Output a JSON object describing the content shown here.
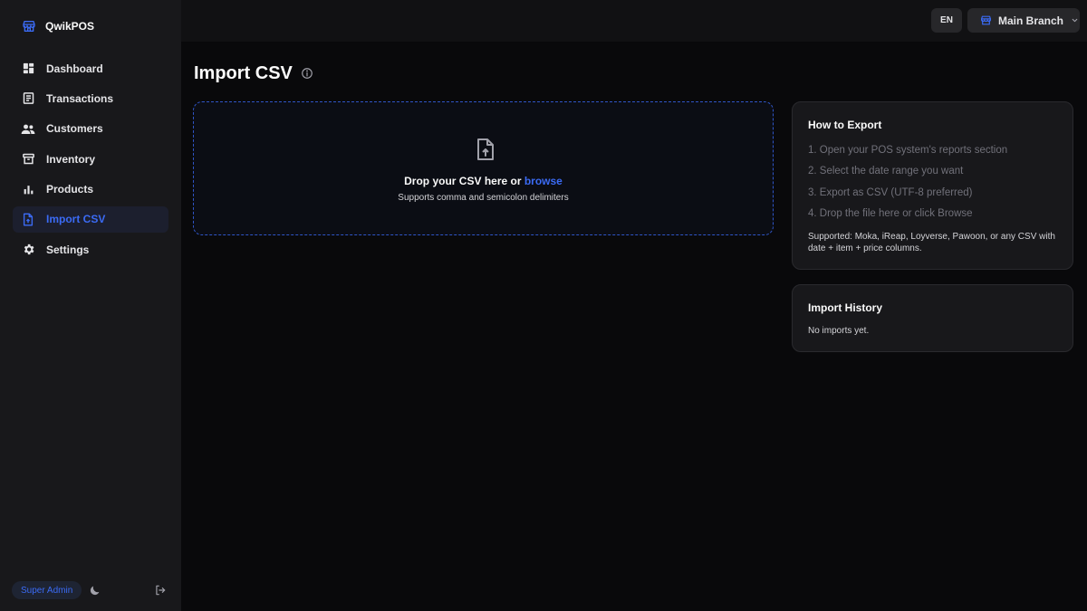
{
  "app": {
    "name": "QwikPOS",
    "accent": "#3b6bf5"
  },
  "sidebar": {
    "items": [
      {
        "label": "Dashboard",
        "icon": "dashboard-icon"
      },
      {
        "label": "Transactions",
        "icon": "receipt-icon"
      },
      {
        "label": "Customers",
        "icon": "users-icon"
      },
      {
        "label": "Inventory",
        "icon": "archive-icon"
      },
      {
        "label": "Products",
        "icon": "bar-chart-icon"
      },
      {
        "label": "Import CSV",
        "icon": "file-upload-icon",
        "active": true
      },
      {
        "label": "Settings",
        "icon": "gear-icon"
      }
    ],
    "footer": {
      "role": "Super Admin",
      "theme_icon": "moon-icon",
      "logout_icon": "logout-icon"
    }
  },
  "topbar": {
    "language": "EN",
    "branch": "Main Branch",
    "branch_icon": "store-icon",
    "chevron_icon": "chevron-down-icon"
  },
  "page": {
    "title": "Import CSV",
    "title_icon": "info-icon"
  },
  "dropzone": {
    "icon": "file-upload-icon",
    "prompt": "Drop your CSV here or",
    "browse": "browse",
    "subtext": "Supports comma and semicolon delimiters"
  },
  "how_to_export": {
    "title": "How to Export",
    "steps": [
      "1. Open your POS system's reports section",
      "2. Select the date range you want",
      "3. Export as CSV (UTF-8 preferred)",
      "4. Drop the file here or click Browse"
    ],
    "supported": "Supported: Moka, iReap, Loyverse, Pawoon, or any CSV with date + item + price columns."
  },
  "import_history": {
    "title": "Import History",
    "empty": "No imports yet."
  }
}
